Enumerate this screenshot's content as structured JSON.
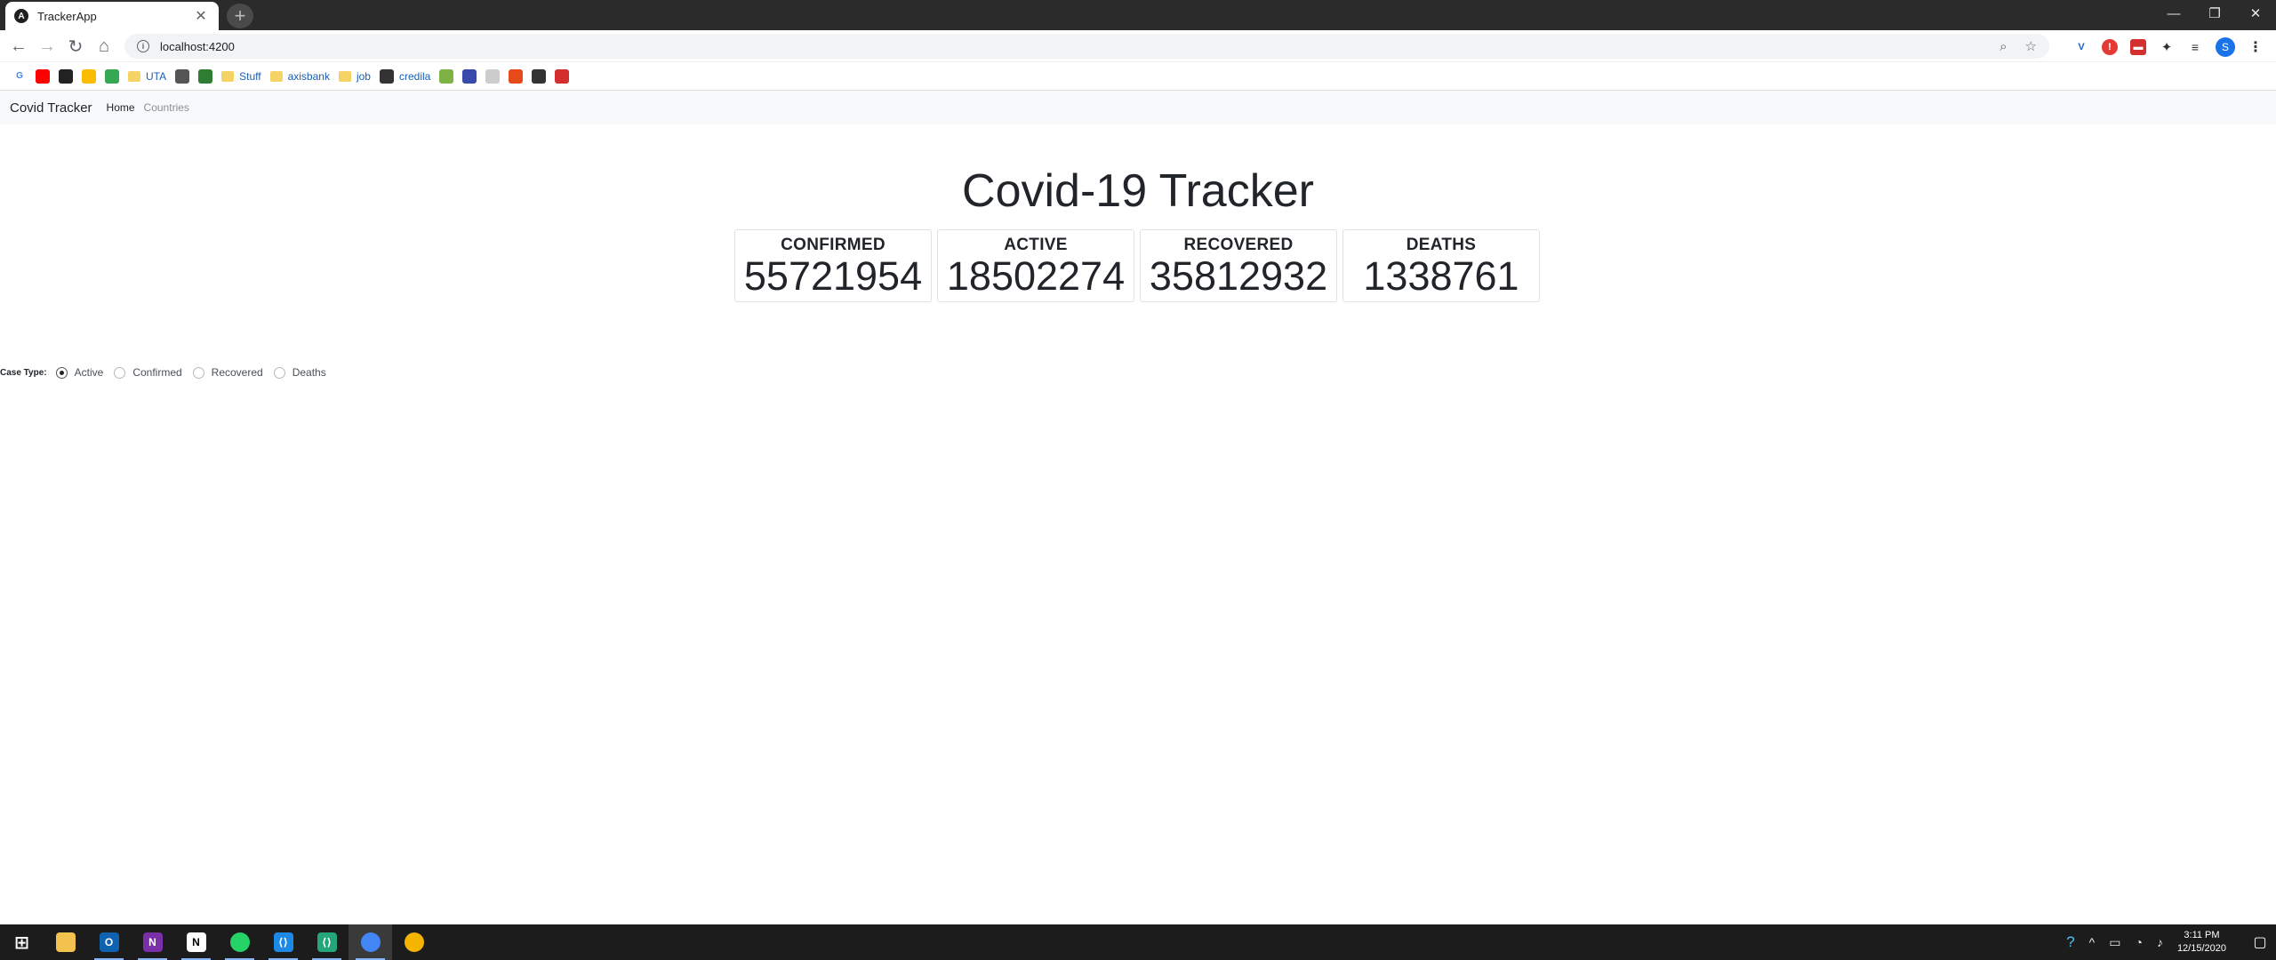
{
  "browser": {
    "tab_title": "TrackerApp",
    "tab_icon_letter": "A",
    "url": "localhost:4200",
    "profile_initial": "S"
  },
  "bookmarks": [
    {
      "label": "",
      "icon": "google-icon",
      "color": "#ffffff"
    },
    {
      "label": "",
      "icon": "youtube-icon",
      "color": "#ff0000"
    },
    {
      "label": "",
      "icon": "amazon-icon",
      "color": "#222222"
    },
    {
      "label": "",
      "icon": "photos-icon",
      "color": "#fbbc04"
    },
    {
      "label": "",
      "icon": "maps-icon",
      "color": "#34a853"
    },
    {
      "label": "UTA",
      "icon": "folder-icon",
      "color": "#f6d365"
    },
    {
      "label": "",
      "icon": "apple-icon",
      "color": "#555555"
    },
    {
      "label": "",
      "icon": "bookmark-icon",
      "color": "#2e7d32"
    },
    {
      "label": "Stuff",
      "icon": "folder-icon",
      "color": "#f6d365"
    },
    {
      "label": "axisbank",
      "icon": "folder-icon",
      "color": "#f6d365"
    },
    {
      "label": "job",
      "icon": "folder-icon",
      "color": "#f6d365"
    },
    {
      "label": "credila",
      "icon": "globe-icon",
      "color": "#333333"
    },
    {
      "label": "",
      "icon": "trello-icon",
      "color": "#7cb342"
    },
    {
      "label": "",
      "icon": "circle-icon",
      "color": "#3949ab"
    },
    {
      "label": "",
      "icon": "gear-icon",
      "color": "#cccccc"
    },
    {
      "label": "",
      "icon": "ft-icon",
      "color": "#e64a19"
    },
    {
      "label": "",
      "icon": "globe-icon",
      "color": "#333333"
    },
    {
      "label": "",
      "icon": "phone-icon",
      "color": "#d32f2f"
    }
  ],
  "app": {
    "brand": "Covid Tracker",
    "nav": [
      "Home",
      "Countries"
    ],
    "heading": "Covid-19 Tracker",
    "stats": [
      {
        "label": "CONFIRMED",
        "value": "55721954"
      },
      {
        "label": "ACTIVE",
        "value": "18502274"
      },
      {
        "label": "RECOVERED",
        "value": "35812932"
      },
      {
        "label": "DEATHS",
        "value": "1338761"
      }
    ],
    "case_type": {
      "label": "Case Type:",
      "options": [
        "Active",
        "Confirmed",
        "Recovered",
        "Deaths"
      ],
      "selected": "Active"
    }
  },
  "taskbar": {
    "apps": [
      {
        "icon": "windows-start-icon",
        "color": "#1c1c1c"
      },
      {
        "icon": "file-explorer-icon",
        "color": "#f2c14e"
      },
      {
        "icon": "outlook-icon",
        "color": "#0f62b0"
      },
      {
        "icon": "onenote-icon",
        "color": "#7b2fa8"
      },
      {
        "icon": "notion-icon",
        "color": "#ffffff"
      },
      {
        "icon": "whatsapp-icon",
        "color": "#25d366"
      },
      {
        "icon": "vscode-icon",
        "color": "#1e88e5"
      },
      {
        "icon": "vscode-insiders-icon",
        "color": "#24a57b"
      },
      {
        "icon": "chrome-icon",
        "color": "#4285f4"
      },
      {
        "icon": "app-icon",
        "color": "#f4b400"
      }
    ],
    "time": "3:11 PM",
    "date": "12/15/2020"
  }
}
